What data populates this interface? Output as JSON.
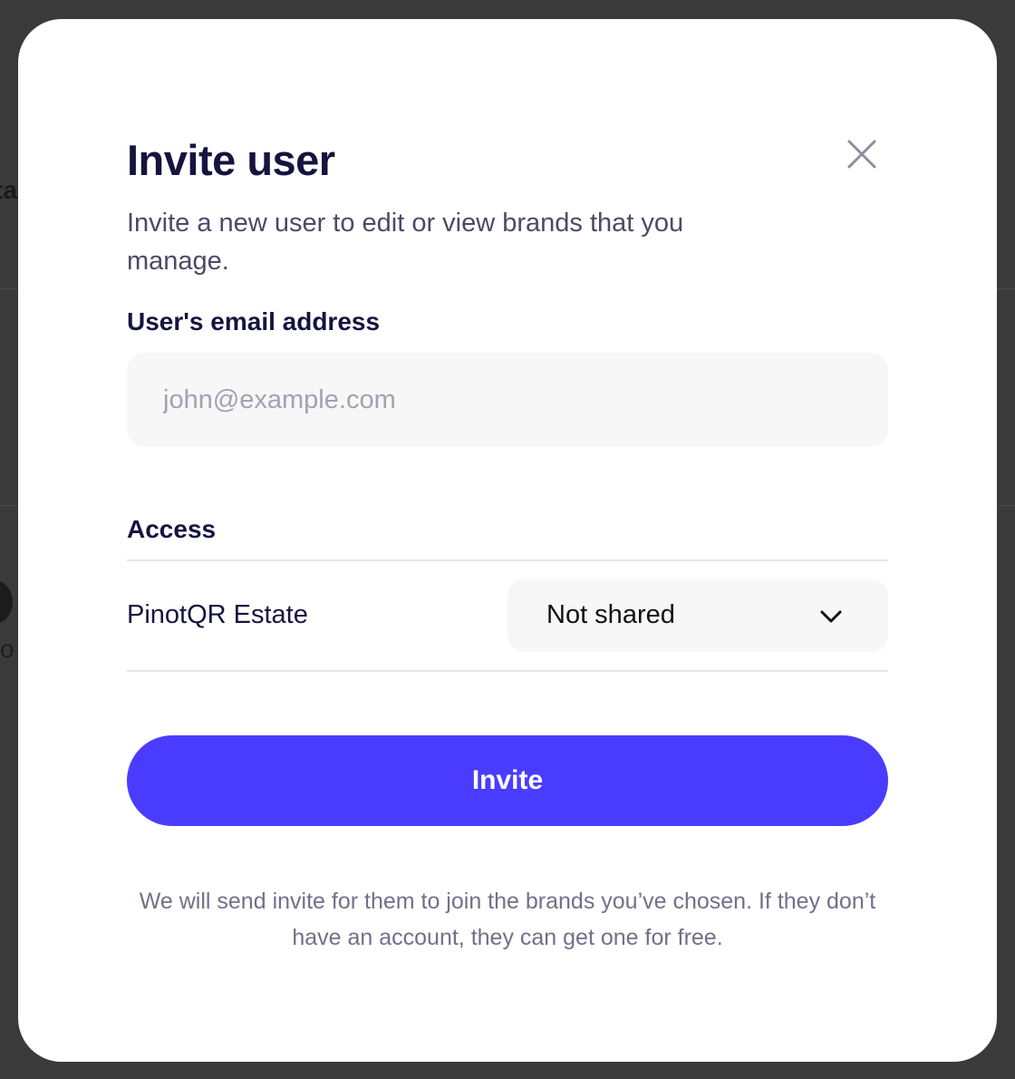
{
  "background": {
    "fragment_top": "ta",
    "fragment_mid": "co"
  },
  "modal": {
    "title": "Invite user",
    "subtitle": "Invite a new user to edit or view brands that you manage.",
    "close_icon": "close-icon",
    "email": {
      "label": "User's email address",
      "placeholder": "john@example.com",
      "value": ""
    },
    "access": {
      "label": "Access",
      "rows": [
        {
          "brand": "PinotQR Estate",
          "selected": "Not shared",
          "icon": "chevron-down-icon"
        }
      ]
    },
    "invite_label": "Invite",
    "footer_note": "We will send invite for them to join the brands you’ve chosen. If they don’t have an account, they can get one for free."
  },
  "colors": {
    "overlay": "#3a3a3a",
    "title": "#15143f",
    "accent": "#4a3cff",
    "input_bg": "#f7f7f8",
    "muted_text": "#71708a"
  }
}
